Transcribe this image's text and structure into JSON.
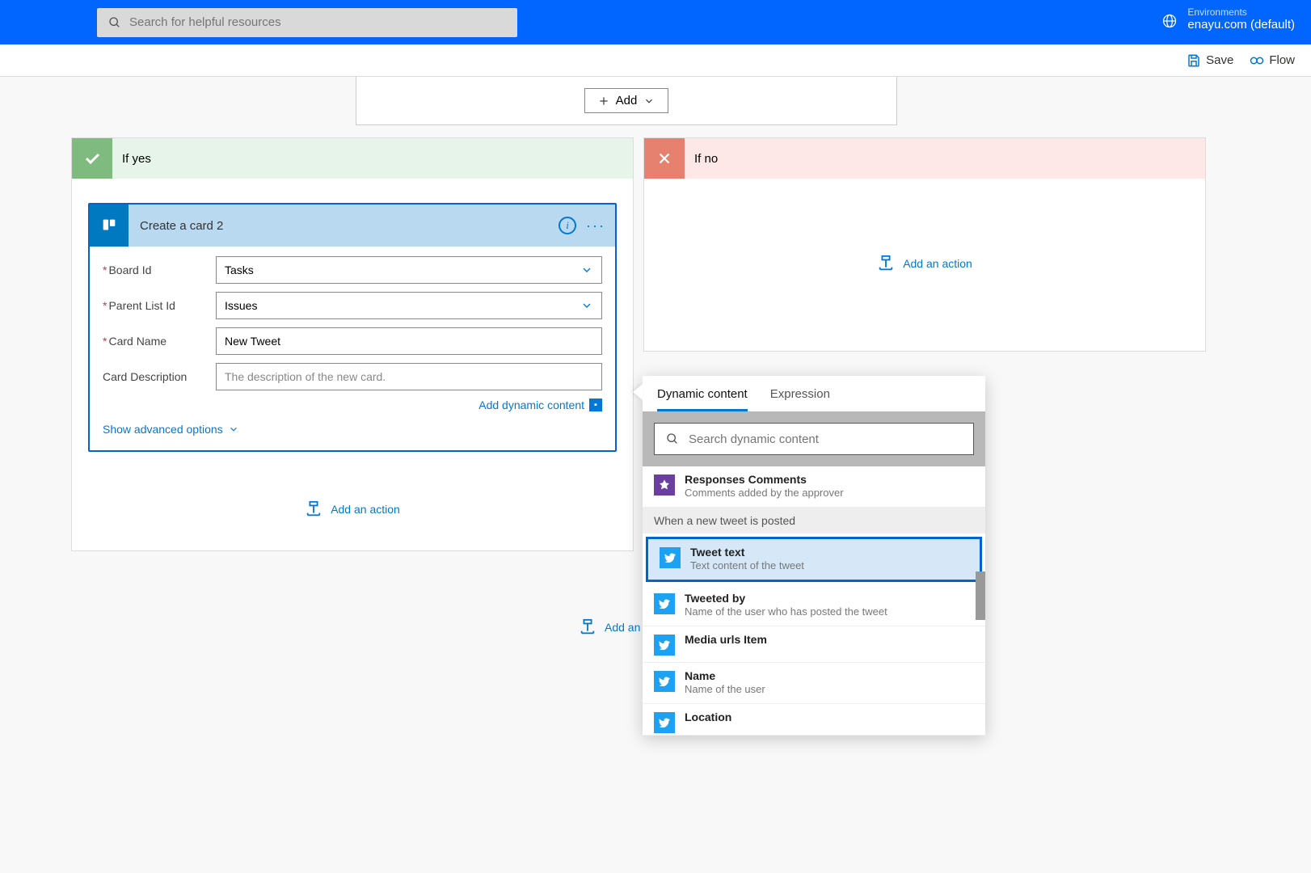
{
  "topbar": {
    "search_placeholder": "Search for helpful resources",
    "env_label": "Environments",
    "env_value": "enayu.com (default)"
  },
  "cmdbar": {
    "save": "Save",
    "flow": "Flow"
  },
  "condition": {
    "add_button": "Add"
  },
  "branches": {
    "yes_label": "If yes",
    "no_label": "If no"
  },
  "action_card": {
    "title": "Create a card 2",
    "fields": {
      "board_id": {
        "label": "Board Id",
        "value": "Tasks"
      },
      "parent_list_id": {
        "label": "Parent List Id",
        "value": "Issues"
      },
      "card_name": {
        "label": "Card Name",
        "value": "New Tweet"
      },
      "card_description": {
        "label": "Card Description",
        "placeholder": "The description of the new card."
      }
    },
    "add_dynamic": "Add dynamic content",
    "show_advanced": "Show advanced options"
  },
  "add_action_label": "Add an action",
  "bottom_add_label": "Add an a",
  "dynamic_content": {
    "tab_dynamic": "Dynamic content",
    "tab_expression": "Expression",
    "search_placeholder": "Search dynamic content",
    "groups": [
      {
        "items": [
          {
            "icon": "approval",
            "title": "Responses Comments",
            "desc": "Comments added by the approver"
          }
        ]
      },
      {
        "header": "When a new tweet is posted",
        "items": [
          {
            "icon": "twitter",
            "title": "Tweet text",
            "desc": "Text content of the tweet",
            "selected": true
          },
          {
            "icon": "twitter",
            "title": "Tweeted by",
            "desc": "Name of the user who has posted the tweet"
          },
          {
            "icon": "twitter",
            "title": "Media urls Item",
            "desc": ""
          },
          {
            "icon": "twitter",
            "title": "Name",
            "desc": "Name of the user"
          },
          {
            "icon": "twitter",
            "title": "Location",
            "desc": ""
          }
        ]
      }
    ]
  }
}
